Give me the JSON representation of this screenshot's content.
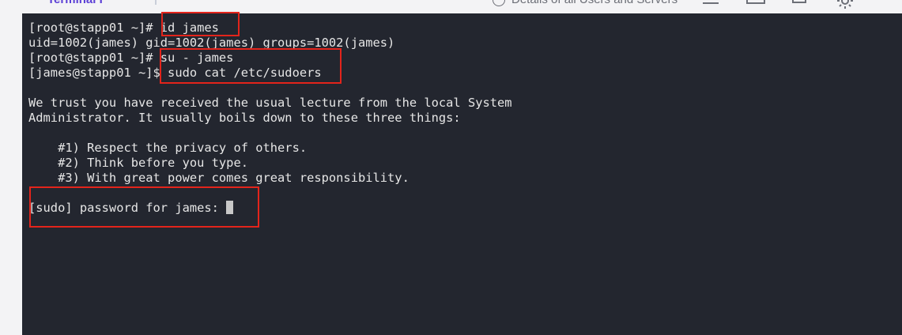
{
  "tabs": {
    "active_label": "Terminal I",
    "details_label": "Details of all Users and Servers",
    "details_icon": "globe-icon"
  },
  "toolbar": {
    "icons": [
      "minimize-icon",
      "window-icon",
      "expand-icon",
      "settings-icon"
    ]
  },
  "terminal": {
    "lines": [
      "[root@stapp01 ~]# id james",
      "uid=1002(james) gid=1002(james) groups=1002(james)",
      "[root@stapp01 ~]# su - james",
      "[james@stapp01 ~]$ sudo cat /etc/sudoers",
      "",
      "We trust you have received the usual lecture from the local System",
      "Administrator. It usually boils down to these three things:",
      "",
      "    #1) Respect the privacy of others.",
      "    #2) Think before you type.",
      "    #3) With great power comes great responsibility.",
      "",
      "[sudo] password for james: "
    ],
    "background": "#23262f",
    "text_color": "#e6e6e6"
  },
  "annotations": {
    "highlight_color": "#e3241b"
  }
}
